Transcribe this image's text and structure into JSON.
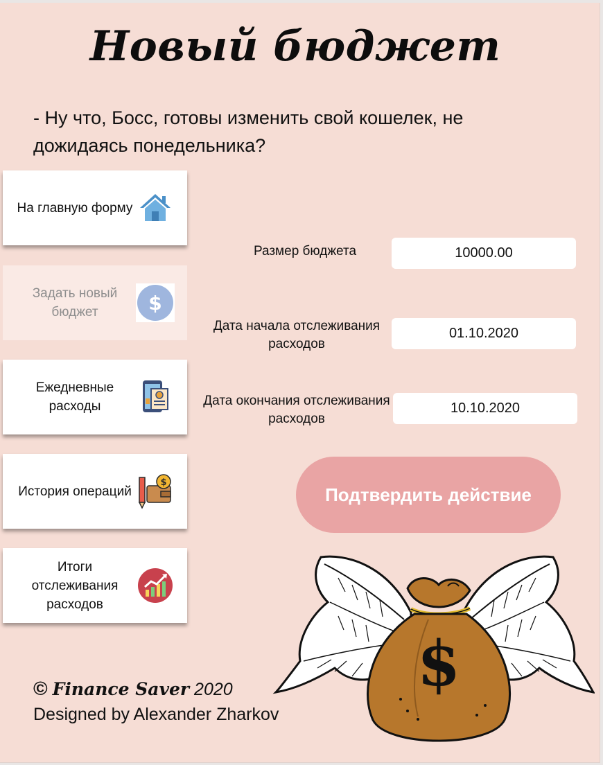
{
  "window": {
    "title": "Новый бюджет",
    "subtitle": "- Ну что, Босс, готовы изменить свой кошелек, не дожидаясь понедельника?"
  },
  "sidebar": {
    "items": [
      {
        "label": "На главную форму",
        "icon": "home-icon",
        "active": false
      },
      {
        "label": "Задать новый бюджет",
        "icon": "dollar-coin-icon",
        "active": true
      },
      {
        "label": "Ежедневные расходы",
        "icon": "phone-receipt-icon",
        "active": false
      },
      {
        "label": "История операций",
        "icon": "wallet-coin-icon",
        "active": false
      },
      {
        "label": "Итоги отслеживания расходов",
        "icon": "growth-chart-icon",
        "active": false
      }
    ]
  },
  "form": {
    "budget_label": "Размер бюджета",
    "budget_value": "10000.00",
    "start_label": "Дата начала отслеживания расходов",
    "start_value": "01.10.2020",
    "end_label": "Дата окончания отслеживания расходов",
    "end_value": "10.10.2020",
    "confirm_label": "Подтвердить действие"
  },
  "footer": {
    "copyright_symbol": "©",
    "brand": "Finance Saver",
    "year": "2020",
    "designer": "Designed by Alexander Zharkov"
  },
  "colors": {
    "background": "#f6ddd5",
    "confirm_button": "#e9a4a4",
    "active_nav": "#faeae5"
  }
}
